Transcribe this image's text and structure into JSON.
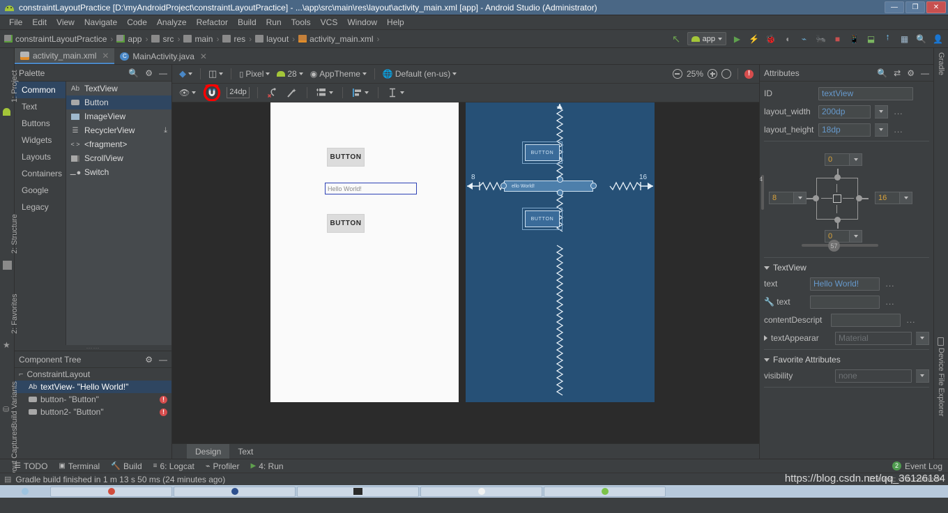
{
  "window": {
    "title": "constraintLayoutPractice [D:\\myAndroidProject\\constraintLayoutPractice] - ...\\app\\src\\main\\res\\layout\\activity_main.xml [app] - Android Studio (Administrator)",
    "icon": "android-robot-icon",
    "minimize": "—",
    "maximize": "❐",
    "close": "✕"
  },
  "menubar": {
    "items": [
      "File",
      "Edit",
      "View",
      "Navigate",
      "Code",
      "Analyze",
      "Refactor",
      "Build",
      "Run",
      "Tools",
      "VCS",
      "Window",
      "Help"
    ]
  },
  "breadcrumb": {
    "items": [
      {
        "label": "constraintLayoutPractice",
        "icon": "module-icon"
      },
      {
        "label": "app",
        "icon": "module-green-icon"
      },
      {
        "label": "src",
        "icon": "folder-icon"
      },
      {
        "label": "main",
        "icon": "folder-icon"
      },
      {
        "label": "res",
        "icon": "res-folder-icon"
      },
      {
        "label": "layout",
        "icon": "folder-icon"
      },
      {
        "label": "activity_main.xml",
        "icon": "xml-file-icon"
      }
    ],
    "separator": "›"
  },
  "nav_toolbar": {
    "back_arrow": "↖",
    "module": "app",
    "buttons": [
      {
        "name": "run-button",
        "glyph": "▶"
      },
      {
        "name": "apply-changes-button",
        "glyph": "⚡"
      },
      {
        "name": "debug-button",
        "glyph": "🐞"
      },
      {
        "name": "attach-debugger-button",
        "glyph": "◖"
      },
      {
        "name": "profiler-button",
        "glyph": "⌁"
      },
      {
        "name": "run-with-coverage-button",
        "glyph": "🐜"
      },
      {
        "name": "stop-button",
        "glyph": "■"
      },
      {
        "name": "avd-manager-button",
        "glyph": "📱"
      },
      {
        "name": "sdk-manager-button",
        "glyph": "⬓"
      },
      {
        "name": "sync-gradle-button",
        "glyph": "⭫"
      },
      {
        "name": "project-structure-button",
        "glyph": "▦"
      },
      {
        "name": "search-everywhere-button",
        "glyph": "🔍"
      },
      {
        "name": "user-button",
        "glyph": "👤"
      }
    ]
  },
  "editor_tabs": [
    {
      "label": "activity_main.xml",
      "icon": "xml-layout-icon",
      "active": true,
      "close": "✕"
    },
    {
      "label": "MainActivity.java",
      "icon": "java-class-icon",
      "active": false,
      "close": "✕"
    }
  ],
  "left_rail": [
    {
      "label": "1: Project",
      "icon": "project-icon"
    },
    {
      "label": "2: Structure",
      "icon": "structure-icon"
    },
    {
      "label": "2: Favorites",
      "icon": "favorites-star-icon"
    },
    {
      "label": "Build Variants",
      "icon": "build-variants-icon"
    },
    {
      "label": "Layout Captures",
      "icon": "layout-captures-icon"
    }
  ],
  "right_rail": [
    {
      "label": "Gradle",
      "icon": "gradle-icon"
    },
    {
      "label": "Device File Explorer",
      "icon": "device-icon"
    }
  ],
  "palette": {
    "title": "Palette",
    "search_icon": "search-icon",
    "gear_icon": "gear-icon",
    "minimize_icon": "minimize-icon",
    "categories": [
      {
        "label": "Common",
        "selected": true
      },
      {
        "label": "Text",
        "selected": false
      },
      {
        "label": "Buttons",
        "selected": false
      },
      {
        "label": "Widgets",
        "selected": false
      },
      {
        "label": "Layouts",
        "selected": false
      },
      {
        "label": "Containers",
        "selected": false
      },
      {
        "label": "Google",
        "selected": false
      },
      {
        "label": "Legacy",
        "selected": false
      }
    ],
    "items": [
      {
        "label": "TextView",
        "icon": "Ab",
        "selected": false,
        "download": false
      },
      {
        "label": "Button",
        "icon": "button-icon",
        "selected": true,
        "download": false
      },
      {
        "label": "ImageView",
        "icon": "image-icon",
        "selected": false,
        "download": false
      },
      {
        "label": "RecyclerView",
        "icon": "list-icon",
        "selected": false,
        "download": true
      },
      {
        "label": "<fragment>",
        "icon": "< >",
        "selected": false,
        "download": false
      },
      {
        "label": "ScrollView",
        "icon": "scroll-icon",
        "selected": false,
        "download": false
      },
      {
        "label": "Switch",
        "icon": "switch-icon",
        "selected": false,
        "download": false
      }
    ]
  },
  "component_tree": {
    "title": "Component Tree",
    "gear_icon": "gear-icon",
    "minimize_icon": "minimize-icon",
    "rows": [
      {
        "label": "ConstraintLayout",
        "icon": "constraint-layout-icon",
        "depth": 0,
        "selected": false,
        "error": false
      },
      {
        "label": "textView- \"Hello World!\"",
        "icon": "Ab",
        "depth": 1,
        "selected": true,
        "error": false
      },
      {
        "label": "button- \"Button\"",
        "icon": "button-icon",
        "depth": 1,
        "selected": false,
        "error": true
      },
      {
        "label": "button2- \"Button\"",
        "icon": "button-icon",
        "depth": 1,
        "selected": false,
        "error": true
      }
    ],
    "error_glyph": "!"
  },
  "design_toolbar": {
    "row1": {
      "design_mode_icon": "layers-icon",
      "orientation_icon": "rotate-icon",
      "device": "Pixel",
      "device_icon": "phone-icon",
      "api": "28",
      "api_icon": "android-icon",
      "theme": "AppTheme",
      "theme_icon": "theme-icon",
      "locale": "Default (en-us)",
      "locale_icon": "globe-icon",
      "zoom_out_icon": "zoom-out-icon",
      "zoom_level": "25%",
      "zoom_in_icon": "zoom-in-icon",
      "zoom_fit_icon": "zoom-to-fit-icon",
      "error_count_icon": "error-icon"
    },
    "row2": {
      "visibility_icon": "eye-icon",
      "autoconnect_icon": "magnet-icon",
      "default_margin": "24dp",
      "clear_constraints_icon": "clear-constraints-icon",
      "infer_constraints_icon": "magic-wand-icon",
      "pack_icon": "pack-icon",
      "align_icon": "align-icon",
      "guidelines_icon": "guidelines-icon",
      "annotation": "red-circle-highlight"
    }
  },
  "canvas": {
    "white_device": {
      "button_top_label": "BUTTON",
      "textview_label": "Hello World!",
      "button_bottom_label": "BUTTON"
    },
    "blueprint_device": {
      "button_top_label": "BUTTON",
      "textview_label": "ello World!",
      "button_bottom_label": "BUTTON",
      "margin_left_label": "8",
      "margin_right_label": "16"
    }
  },
  "design_tabs": [
    {
      "label": "Design",
      "active": true
    },
    {
      "label": "Text",
      "active": false
    }
  ],
  "attributes": {
    "title": "Attributes",
    "search_icon": "search-icon",
    "toggle_icon": "arrows-toggle-icon",
    "gear_icon": "gear-icon",
    "minimize_icon": "minimize-icon",
    "id_label": "ID",
    "id_value": "textView",
    "layout_width_label": "layout_width",
    "layout_width_value": "200dp",
    "layout_height_label": "layout_height",
    "layout_height_value": "18dp",
    "dots": "...",
    "constraint_widget": {
      "top_margin": "0",
      "left_margin": "8",
      "right_margin": "16",
      "bottom_margin": "0",
      "bias_value": "57",
      "vertical_bias_label": "4"
    },
    "textview_section": {
      "title": "TextView",
      "text_label": "text",
      "text_value": "Hello World!",
      "text_design_label": "text",
      "text_design_value": "",
      "content_desc_label": "contentDescript",
      "content_desc_value": "",
      "text_appearance_label": "textAppearar",
      "text_appearance_value": "Material"
    },
    "favorites_section": {
      "title": "Favorite Attributes",
      "visibility_label": "visibility",
      "visibility_value": "none"
    }
  },
  "footer": {
    "tabs": [
      {
        "label": "TODO",
        "icon": "todo-icon"
      },
      {
        "label": "Terminal",
        "icon": "terminal-icon"
      },
      {
        "label": "Build",
        "icon": "build-hammer-icon"
      },
      {
        "label": "6: Logcat",
        "icon": "logcat-icon"
      },
      {
        "label": "Profiler",
        "icon": "profiler-icon"
      },
      {
        "label": "4: Run",
        "icon": "run-icon"
      }
    ],
    "event_log": "Event Log",
    "event_count": "2",
    "status_icon": "memory-icon",
    "status_text": "Gradle build finished in 1 m 13 s 50 ms (24 minutes ago)",
    "watermark": "https://blog.csdn.net/qq_36126184",
    "status_right": "Context: <no context>"
  },
  "colors": {
    "accent_blue": "#4a88c7",
    "selection_blue": "#2f4661",
    "blueprint_bg": "#265076",
    "error_red": "#d64d4d",
    "annotation_red": "#ff0000",
    "title_bar": "#4a6785",
    "panel_bg": "#3c3f41",
    "canvas_bg": "#2b2b2b"
  }
}
